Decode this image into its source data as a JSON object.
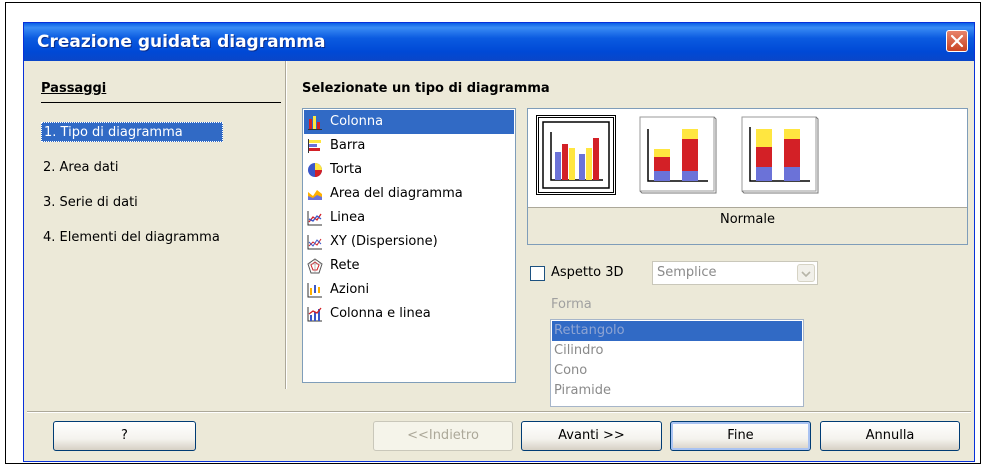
{
  "window": {
    "title": "Creazione guidata diagramma"
  },
  "steps": {
    "heading": "Passaggi",
    "items": [
      "1. Tipo di diagramma",
      "2. Area dati",
      "3. Serie di dati",
      "4. Elementi del diagramma"
    ],
    "selected_index": 0
  },
  "chart_type": {
    "heading": "Selezionate un tipo di diagramma",
    "items": [
      {
        "label": "Colonna",
        "icon": "column-chart-icon"
      },
      {
        "label": "Barra",
        "icon": "bar-chart-icon"
      },
      {
        "label": "Torta",
        "icon": "pie-chart-icon"
      },
      {
        "label": "Area del diagramma",
        "icon": "area-chart-icon"
      },
      {
        "label": "Linea",
        "icon": "line-chart-icon"
      },
      {
        "label": "XY (Dispersione)",
        "icon": "xy-scatter-chart-icon"
      },
      {
        "label": "Rete",
        "icon": "net-chart-icon"
      },
      {
        "label": "Azioni",
        "icon": "stock-chart-icon"
      },
      {
        "label": "Colonna e linea",
        "icon": "column-and-line-chart-icon"
      }
    ],
    "selected_index": 0
  },
  "variants": {
    "items": [
      "normal-variant-icon",
      "stacked-variant-icon",
      "percent-stacked-variant-icon"
    ],
    "selected_index": 0,
    "caption": "Normale"
  },
  "options": {
    "aspect3d_label": "Aspetto 3D",
    "aspect3d_checked": false,
    "scheme_value": "Semplice",
    "form_label": "Forma",
    "shapes": [
      "Rettangolo",
      "Cilindro",
      "Cono",
      "Piramide"
    ],
    "shape_selected_index": 0
  },
  "buttons": {
    "help": "?",
    "back": "<<Indietro",
    "next": "Avanti >>",
    "finish": "Fine",
    "cancel": "Annulla"
  },
  "colors": {
    "selection": "#316AC5",
    "dialog_bg": "#ECE9D8",
    "title_blue": "#0054E3",
    "bar_red": "#D32026",
    "bar_yellow": "#FFE640",
    "bar_blue": "#6B72D8"
  }
}
